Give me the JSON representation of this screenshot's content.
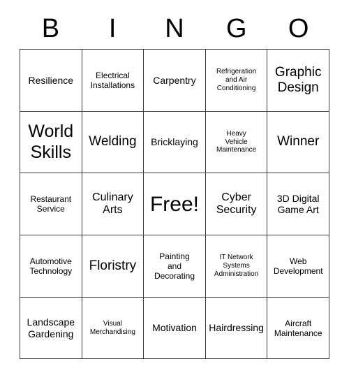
{
  "card": {
    "title": "BINGO",
    "header_letters": [
      "B",
      "I",
      "N",
      "G",
      "O"
    ],
    "rows": [
      [
        {
          "text": "Resilience",
          "size": "m"
        },
        {
          "text": "Electrical\nInstallations",
          "size": "s"
        },
        {
          "text": "Carpentry",
          "size": "m"
        },
        {
          "text": "Refrigeration\nand Air\nConditioning",
          "size": "xs"
        },
        {
          "text": "Graphic\nDesign",
          "size": "xl"
        }
      ],
      [
        {
          "text": "World\nSkills",
          "size": "xxl"
        },
        {
          "text": "Welding",
          "size": "xl"
        },
        {
          "text": "Bricklaying",
          "size": "m"
        },
        {
          "text": "Heavy\nVehicle\nMaintenance",
          "size": "xs"
        },
        {
          "text": "Winner",
          "size": "xl"
        }
      ],
      [
        {
          "text": "Restaurant\nService",
          "size": "s"
        },
        {
          "text": "Culinary\nArts",
          "size": "l"
        },
        {
          "text": "Free!",
          "size": "free"
        },
        {
          "text": "Cyber\nSecurity",
          "size": "l"
        },
        {
          "text": "3D Digital\nGame Art",
          "size": "m"
        }
      ],
      [
        {
          "text": "Automotive\nTechnology",
          "size": "s"
        },
        {
          "text": "Floristry",
          "size": "xl"
        },
        {
          "text": "Painting\nand\nDecorating",
          "size": "s"
        },
        {
          "text": "IT Network\nSystems\nAdministration",
          "size": "xs"
        },
        {
          "text": "Web\nDevelopment",
          "size": "s"
        }
      ],
      [
        {
          "text": "Landscape\nGardening",
          "size": "m"
        },
        {
          "text": "Visual\nMerchandising",
          "size": "xs"
        },
        {
          "text": "Motivation",
          "size": "m"
        },
        {
          "text": "Hairdressing",
          "size": "m"
        },
        {
          "text": "Aircraft\nMaintenance",
          "size": "s"
        }
      ]
    ]
  },
  "colors": {
    "background": "#ffffff",
    "border": "#3a3a3a",
    "text": "#000000"
  }
}
